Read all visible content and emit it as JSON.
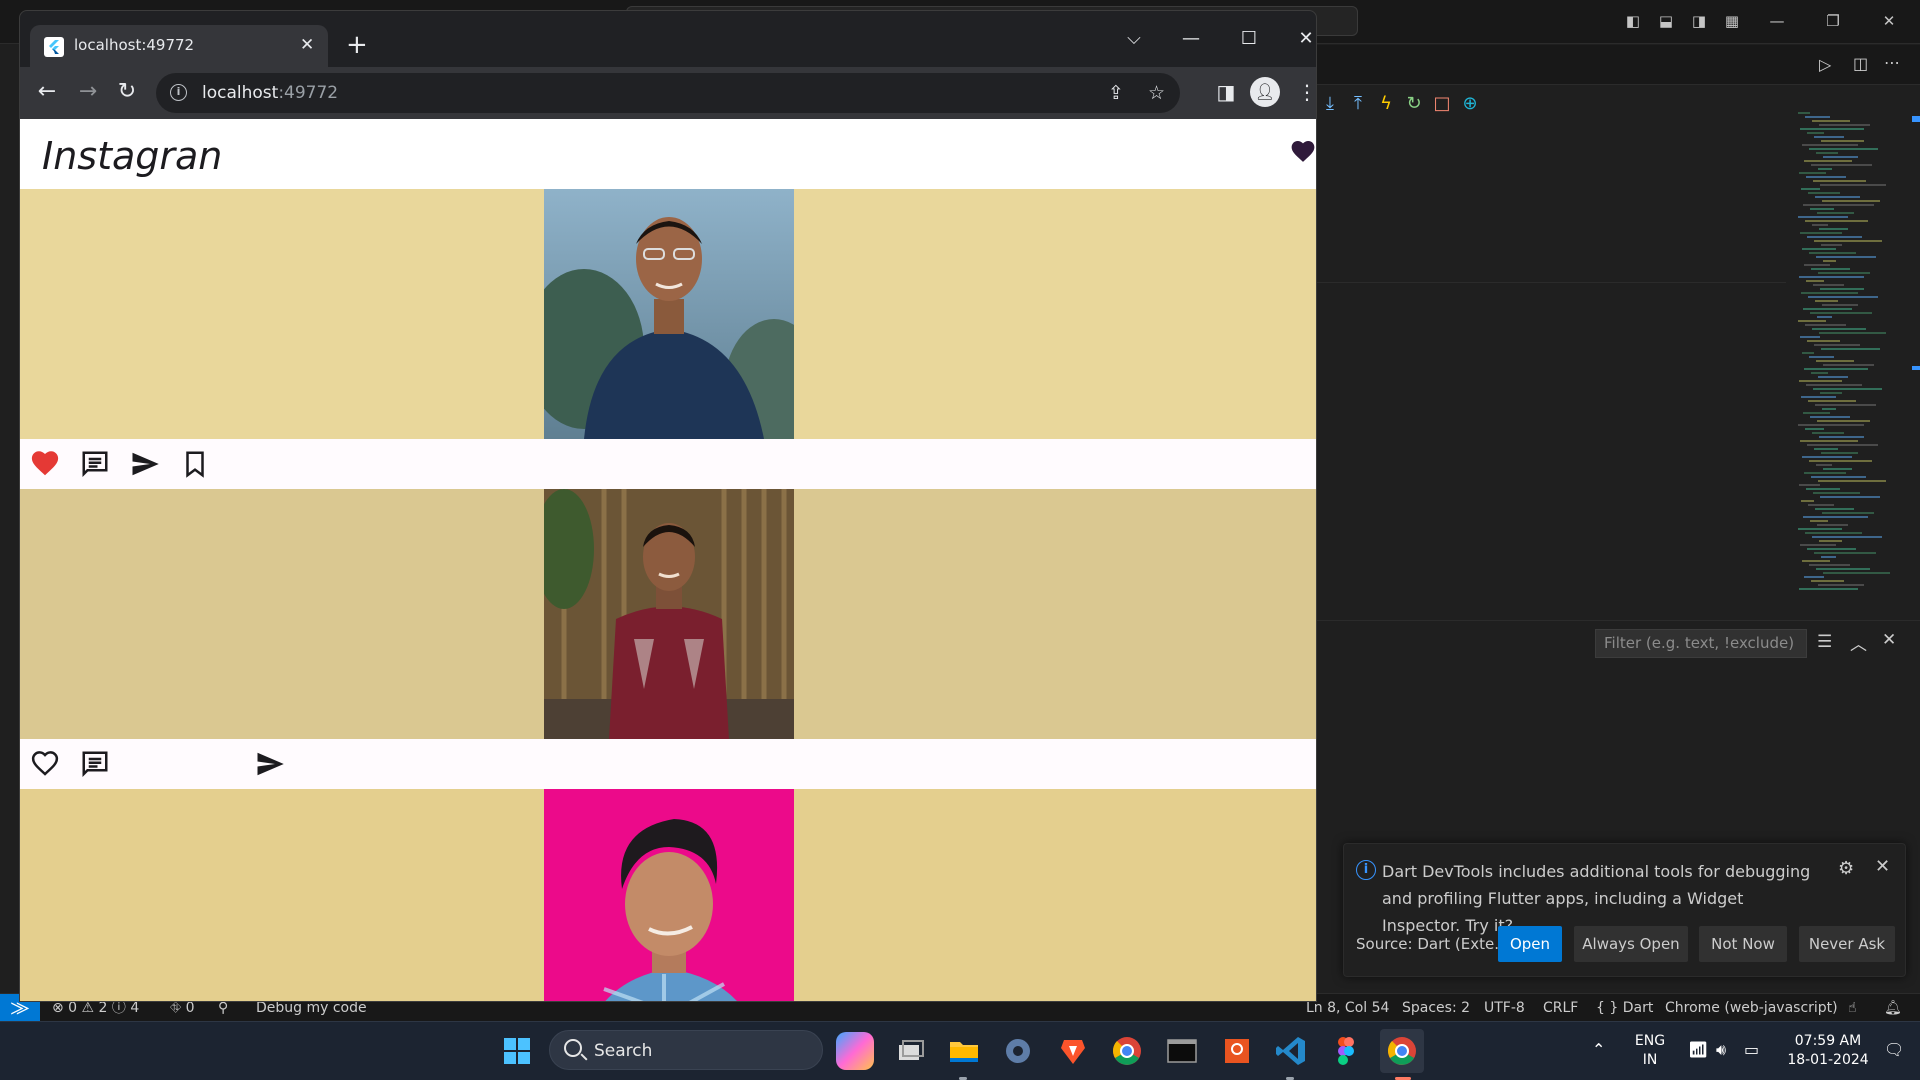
{
  "vscode": {
    "status": {
      "problems": "⊗ 0 ⚠ 2 ⓘ 4",
      "ports": "⛗ 0",
      "debug_config": "Debug my code",
      "position": "Ln 8, Col 54",
      "spaces": "Spaces: 2",
      "encoding": "UTF-8",
      "eol": "CRLF",
      "language": "{ } Dart",
      "device": "Chrome (web-javascript)"
    },
    "panel": {
      "filter_placeholder": "Filter (e.g. text, !exclude)"
    },
    "notification": {
      "message": "Dart DevTools includes additional tools for debugging and profiling Flutter apps, including a Widget Inspector. Try it?",
      "source": "Source: Dart (Exte...",
      "buttons": {
        "open": "Open",
        "always_open": "Always Open",
        "not_now": "Not Now",
        "never_ask": "Never Ask"
      }
    }
  },
  "chrome": {
    "tab_title": "localhost:49772",
    "url_host": "localhost",
    "url_port": ":49772"
  },
  "app": {
    "title": "Instagran",
    "heart_color": "#2f1a3a",
    "posts": [
      {
        "bg": "#e9d79b",
        "photo": "person-1",
        "liked": true,
        "show_bookmark": true
      },
      {
        "bg": "#dac891",
        "photo": "person-2",
        "liked": false,
        "show_bookmark": false
      },
      {
        "bg": "#e4cf8e",
        "photo": "person-3",
        "liked": false,
        "show_bookmark": false
      }
    ]
  },
  "taskbar": {
    "search_label": "Search",
    "language": "ENG",
    "region": "IN",
    "time": "07:59 AM",
    "date": "18-01-2024"
  }
}
